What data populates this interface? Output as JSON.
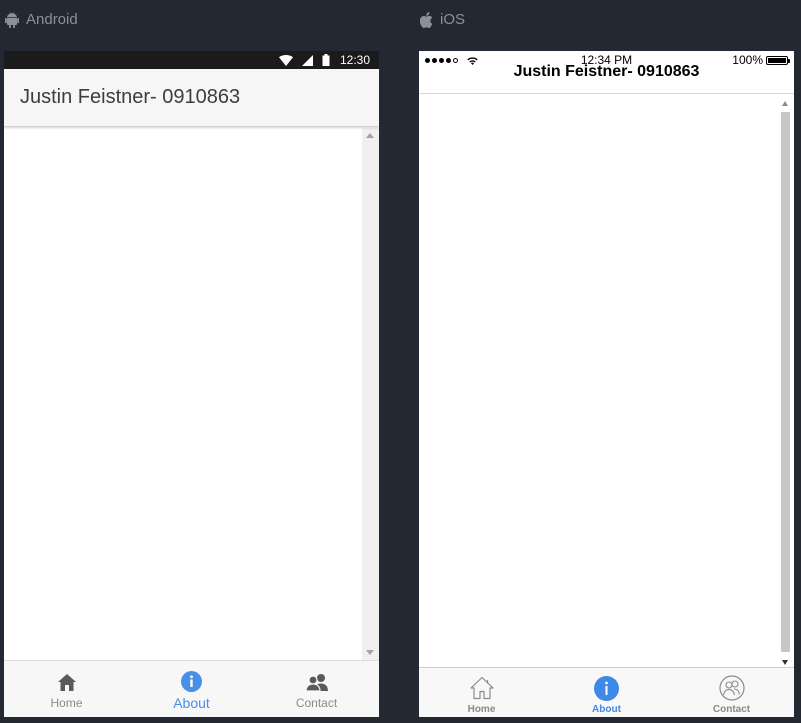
{
  "platforms": {
    "android": {
      "label": "Android"
    },
    "ios": {
      "label": "iOS"
    }
  },
  "android": {
    "status": {
      "time": "12:30"
    },
    "title": "Justin Feistner- 0910863",
    "tabs": [
      {
        "label": "Home",
        "icon": "home-icon",
        "active": false
      },
      {
        "label": "About",
        "icon": "info-icon",
        "active": true
      },
      {
        "label": "Contact",
        "icon": "contact-icon",
        "active": false
      }
    ]
  },
  "ios": {
    "status": {
      "time": "12:34 PM",
      "battery": "100%"
    },
    "title": "Justin Feistner- 0910863",
    "tabs": [
      {
        "label": "Home",
        "icon": "home-icon",
        "active": false
      },
      {
        "label": "About",
        "icon": "info-icon",
        "active": true
      },
      {
        "label": "Contact",
        "icon": "contact-icon",
        "active": false
      }
    ]
  },
  "colors": {
    "background": "#232833",
    "accent": "#4a8ee5",
    "inactive": "#8a8a8a"
  }
}
